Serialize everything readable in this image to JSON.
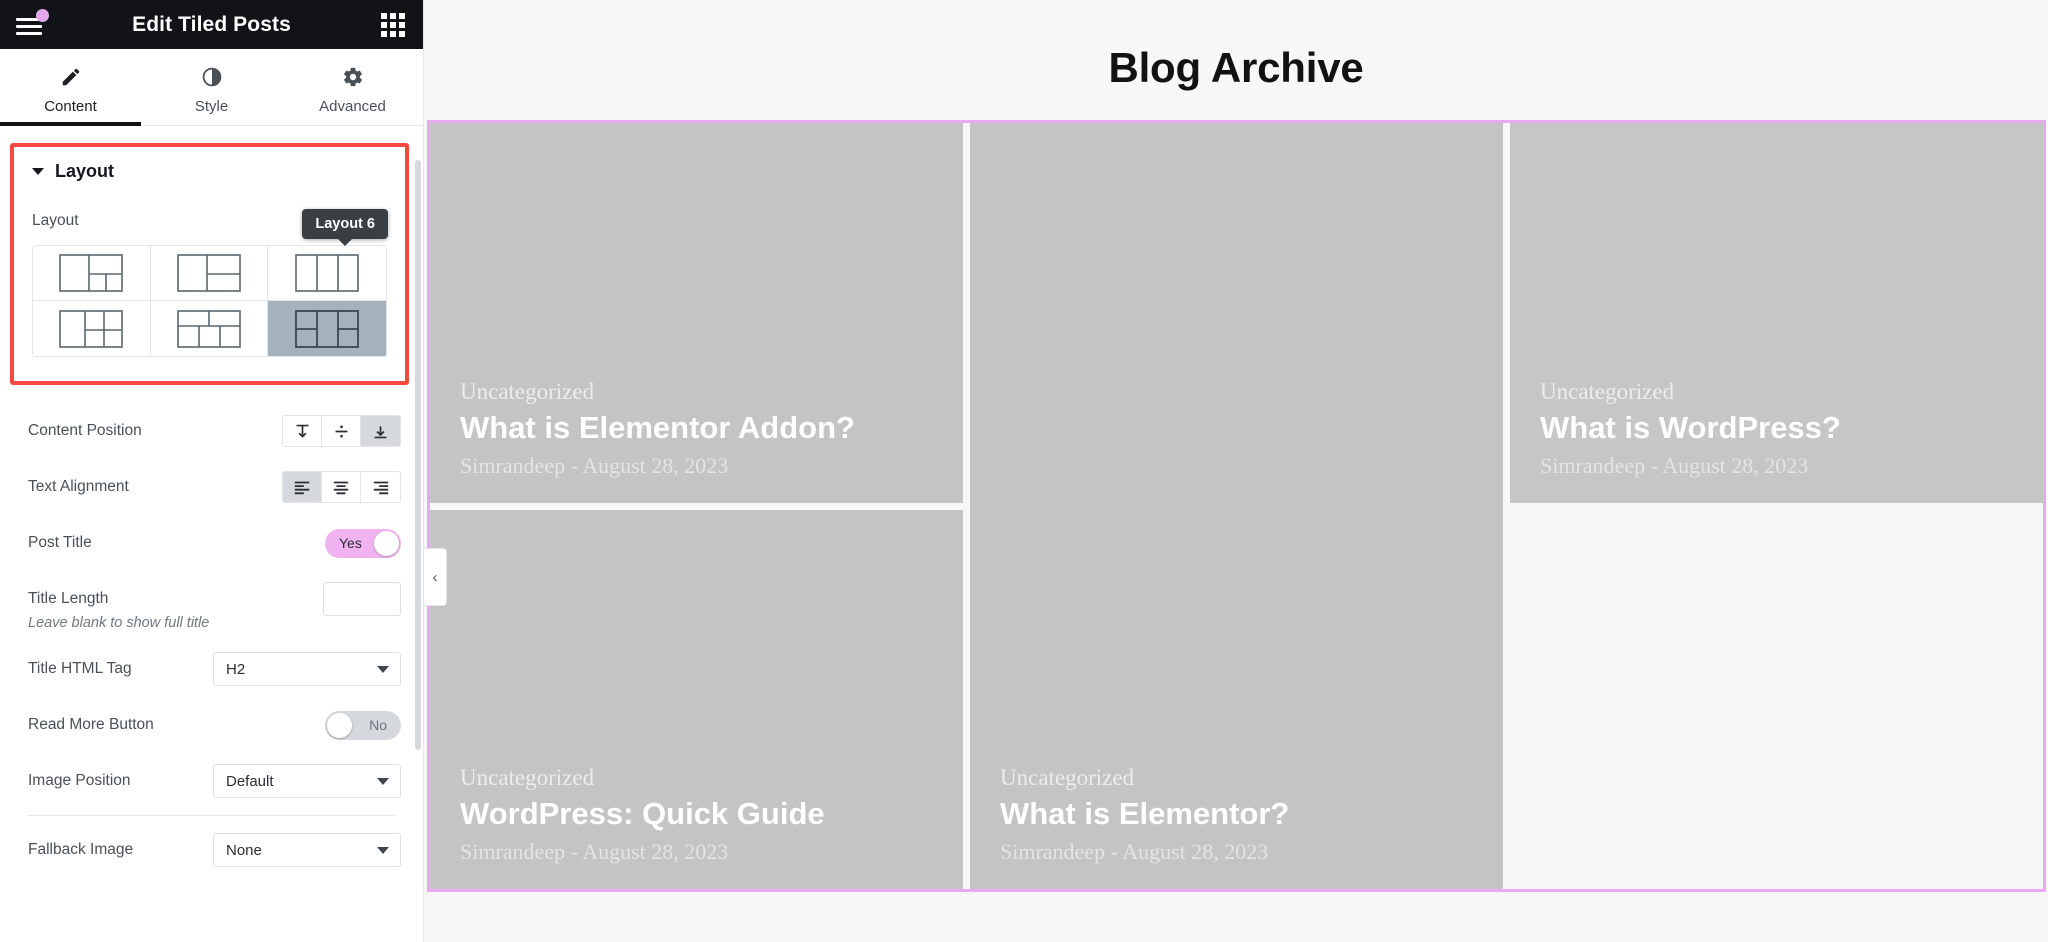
{
  "panel": {
    "header": {
      "title": "Edit Tiled Posts",
      "menu_icon": "hamburger-menu-icon",
      "notification_dot_color": "#e4a8ee",
      "apps_icon": "apps-grid-icon"
    },
    "tabs": [
      {
        "label": "Content",
        "icon": "pencil-icon",
        "active": true
      },
      {
        "label": "Style",
        "icon": "half-circle-contrast-icon",
        "active": false
      },
      {
        "label": "Advanced",
        "icon": "gear-icon",
        "active": false
      }
    ],
    "highlight_color": "#f54a3f",
    "section": {
      "title": "Layout",
      "field_label": "Layout",
      "tooltip": "Layout 6",
      "options": [
        {
          "name": "layout-1",
          "selected": false
        },
        {
          "name": "layout-2",
          "selected": false
        },
        {
          "name": "layout-3",
          "selected": false
        },
        {
          "name": "layout-4",
          "selected": false
        },
        {
          "name": "layout-5",
          "selected": false
        },
        {
          "name": "layout-6",
          "selected": true
        }
      ]
    },
    "controls": {
      "content_position": {
        "label": "Content Position",
        "options": [
          "Top",
          "Middle",
          "Bottom"
        ],
        "selected": "Bottom"
      },
      "text_alignment": {
        "label": "Text Alignment",
        "options": [
          "Left",
          "Center",
          "Right"
        ],
        "selected": "Left"
      },
      "post_title": {
        "label": "Post Title",
        "value": "Yes",
        "on": true
      },
      "title_length": {
        "label": "Title Length",
        "value": "",
        "placeholder": ""
      },
      "title_length_hint": "Leave blank to show full title",
      "title_html_tag": {
        "label": "Title HTML Tag",
        "value": "H2"
      },
      "read_more_button": {
        "label": "Read More Button",
        "value": "No",
        "on": false
      },
      "image_position": {
        "label": "Image Position",
        "value": "Default"
      },
      "fallback_image": {
        "label": "Fallback Image",
        "value": "None"
      }
    }
  },
  "collapse_handle": {
    "icon": "chevron-left-icon",
    "label": "‹"
  },
  "preview": {
    "title": "Blog Archive",
    "frame_color": "#e9a9f0",
    "tiles": [
      {
        "category": "Uncategorized",
        "title": "What is Elementor Addon?",
        "meta": "Simrandeep - August 28, 2023"
      },
      {
        "category": "Uncategorized",
        "title": "What is Elementor?",
        "meta": "Simrandeep - August 28, 2023"
      },
      {
        "category": "Uncategorized",
        "title": "What is WordPress?",
        "meta": "Simrandeep - August 28, 2023"
      },
      {
        "category": "Uncategorized",
        "title": "WordPress: Quick Guide",
        "meta": "Simrandeep - August 28, 2023"
      }
    ]
  }
}
